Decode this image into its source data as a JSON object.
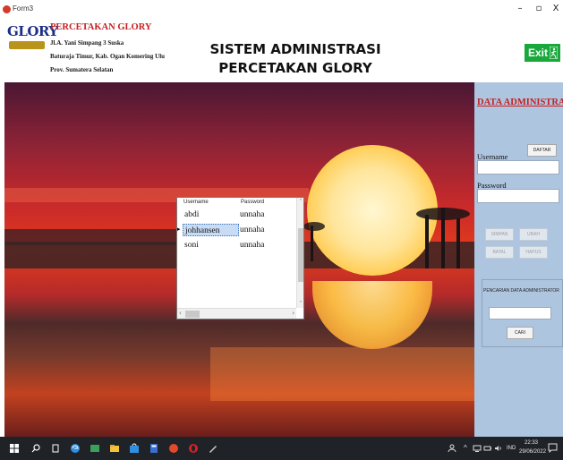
{
  "window": {
    "title": "Form3",
    "minimize_glyph": "–",
    "maximize_glyph": "▫",
    "close_glyph": "X"
  },
  "header": {
    "logo_text": "GLORY",
    "company_name": "PERCETAKAN GLORY",
    "address_line1": "Jl.A. Yani Simpang 3 Suska",
    "address_line2": "Baturaja Timur, Kab. Ogan Komering Ulu",
    "address_line3": "Prov. Sumatera Selatan",
    "system_title_line1": "SISTEM ADMINISTRASI",
    "system_title_line2": "PERCETAKAN GLORY",
    "exit_label": "Exit"
  },
  "grid": {
    "columns": [
      "Username",
      "Password"
    ],
    "rows": [
      {
        "username": "abdi",
        "password": "unnaha",
        "selected": false
      },
      {
        "username": "johhansen",
        "password": "unnaha",
        "selected": true
      },
      {
        "username": "soni",
        "password": "unnaha",
        "selected": false
      }
    ],
    "row_selector_glyph": "▸"
  },
  "panel": {
    "title": "DATA ADMINISTRASI",
    "username_label": "Username",
    "password_label": "Password",
    "username_value": "",
    "password_value": "",
    "daftar_label": "DAFTAR",
    "simpan_label": "SIMPAN",
    "ubah_label": "UBAH",
    "batal_label": "BATAL",
    "hapus_label": "HAPUS",
    "search_label": "PENCARIAN DATA ADMINISTRATOR",
    "search_value": "",
    "cari_label": "CARI"
  },
  "taskbar": {
    "time": "22:33",
    "date": "29/06/2022",
    "language": "IND"
  },
  "colors": {
    "accent_red": "#c81e1e",
    "navy": "#1d2f86",
    "exit_green": "#19a83b",
    "panel_blue": "#aec5e0",
    "taskbar": "#1f2227"
  }
}
